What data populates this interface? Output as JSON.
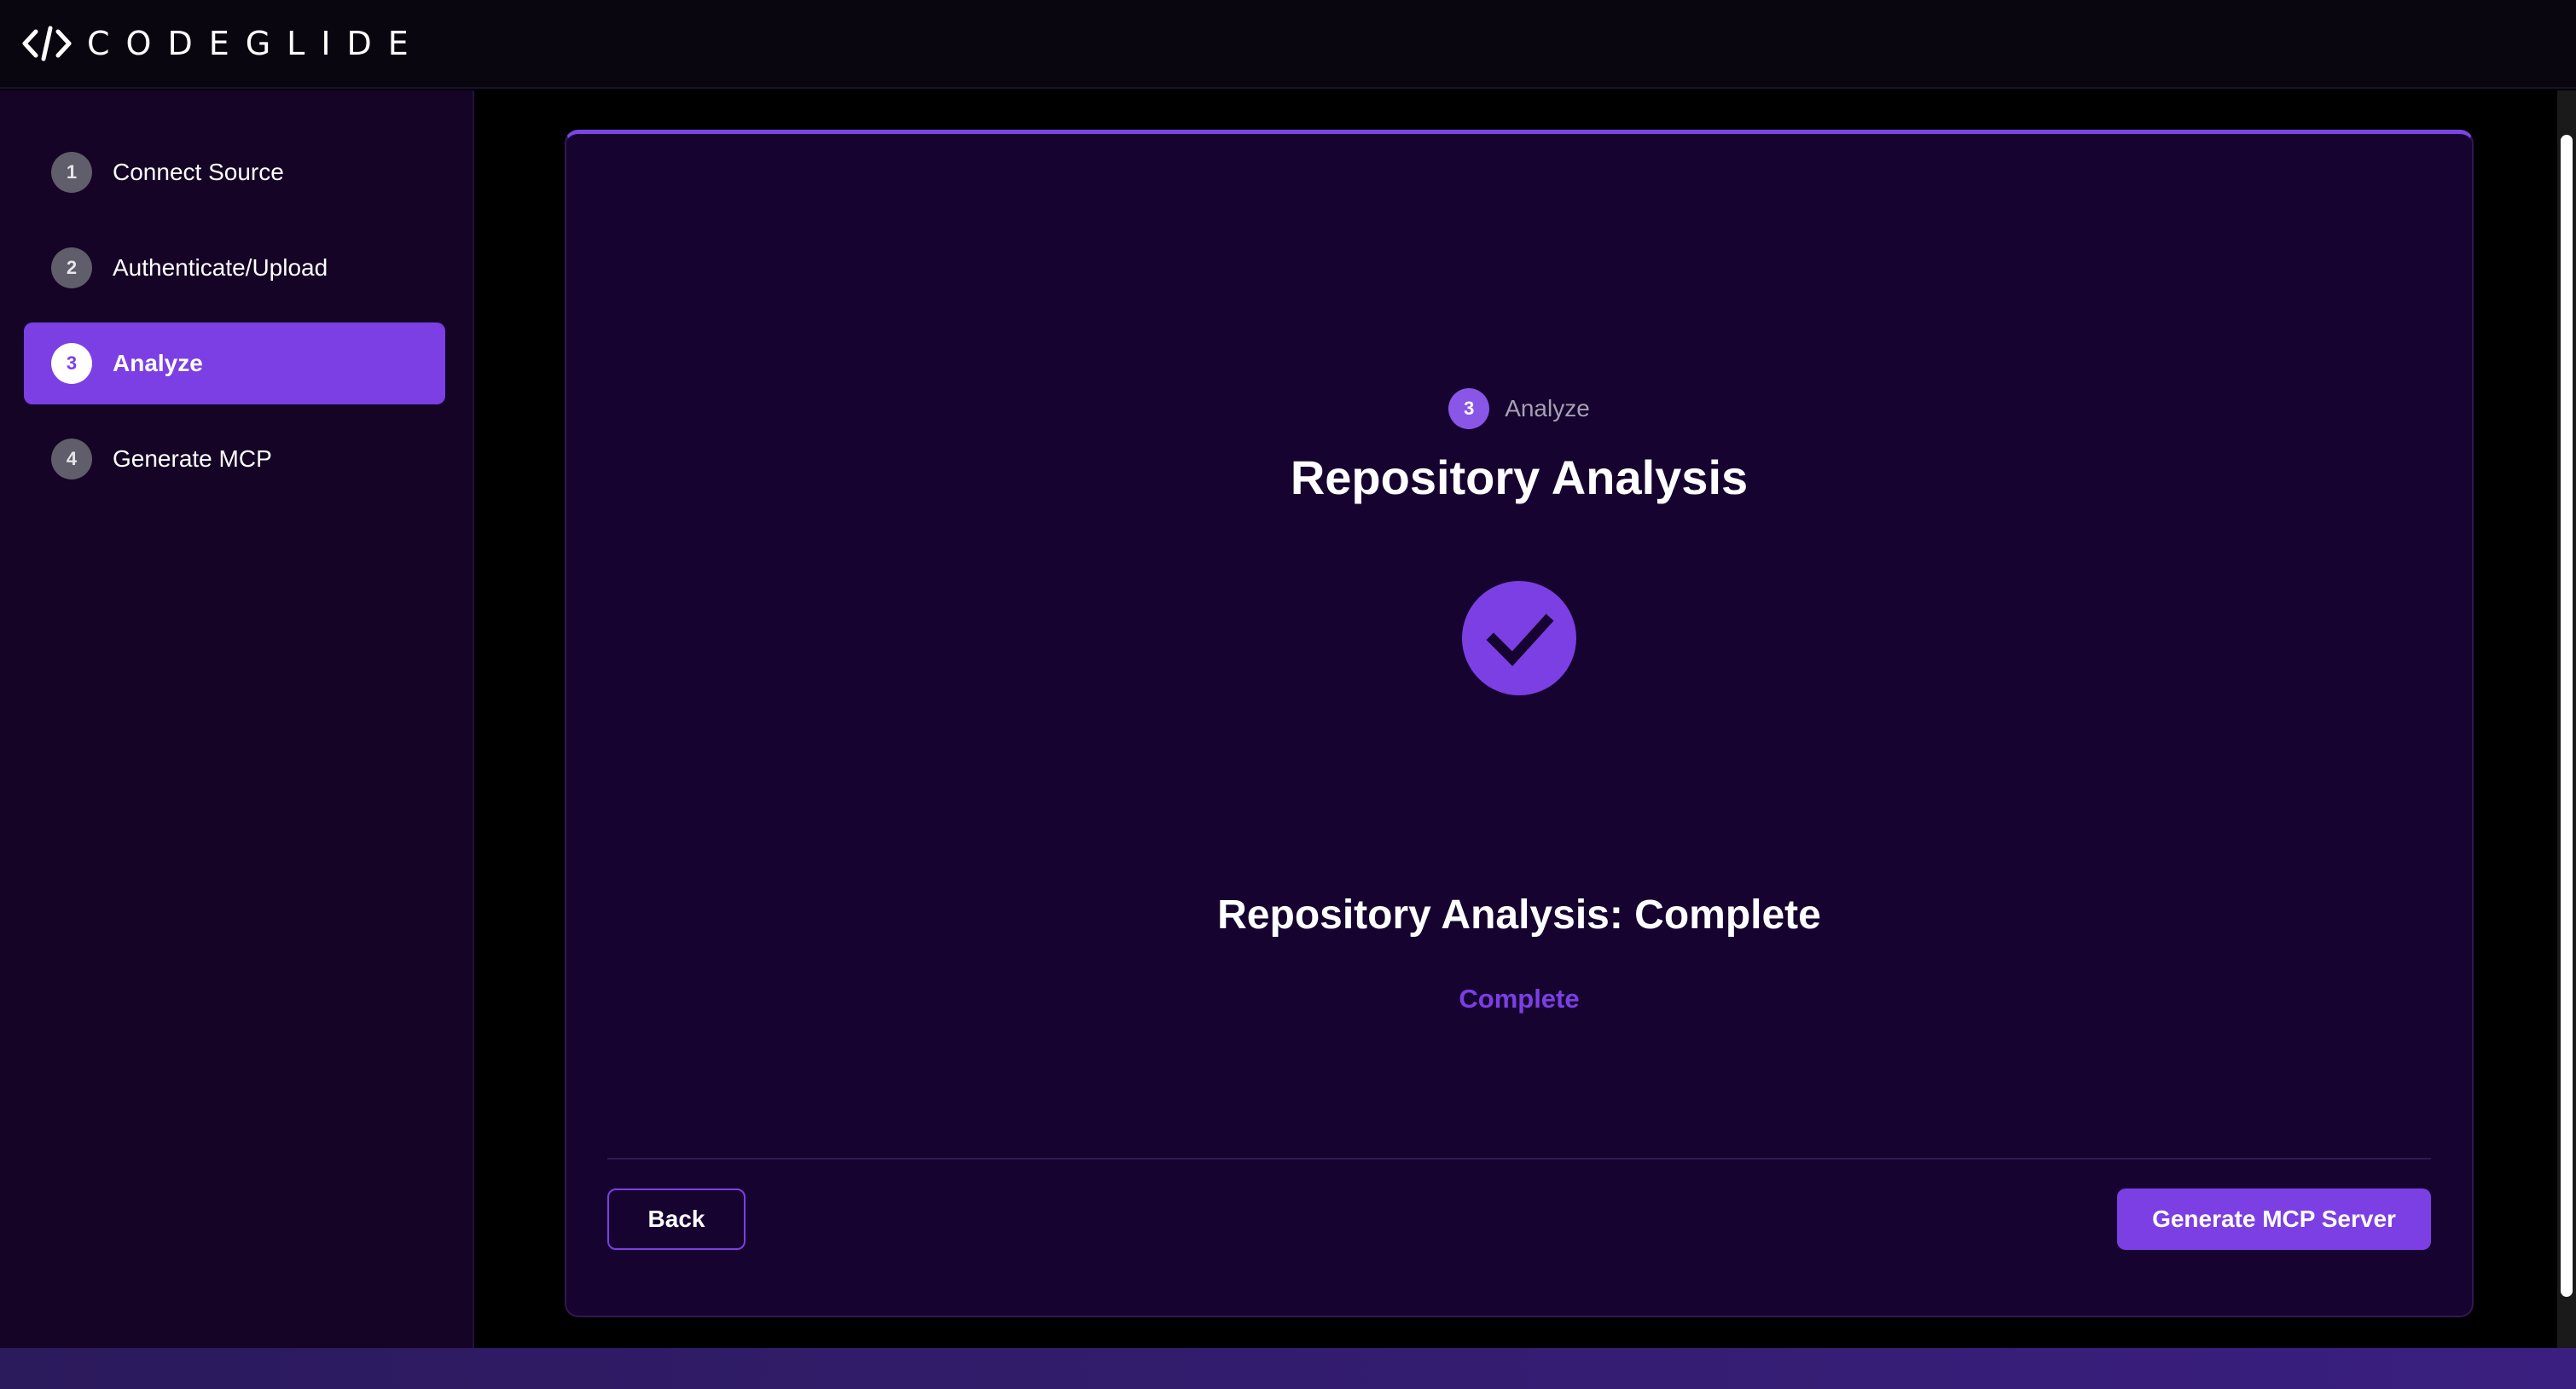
{
  "app": {
    "brand": "CODEGLIDE",
    "logo_icon": "code-brackets-icon"
  },
  "sidebar": {
    "items": [
      {
        "number": "1",
        "label": "Connect Source",
        "state": "inactive"
      },
      {
        "number": "2",
        "label": "Authenticate/Upload",
        "state": "inactive"
      },
      {
        "number": "3",
        "label": "Analyze",
        "state": "active"
      },
      {
        "number": "4",
        "label": "Generate MCP",
        "state": "inactive"
      }
    ]
  },
  "main": {
    "step_badge": {
      "number": "3",
      "label": "Analyze"
    },
    "title": "Repository Analysis",
    "status_icon": "check-circle-icon",
    "subtitle": "Repository Analysis: Complete",
    "status_text": "Complete",
    "back_label": "Back",
    "primary_label": "Generate MCP Server"
  },
  "colors": {
    "accent": "#7b3fe4",
    "sidebar_bg": "#150426",
    "card_bg": "#160330",
    "topbar_bg": "#09060f"
  }
}
